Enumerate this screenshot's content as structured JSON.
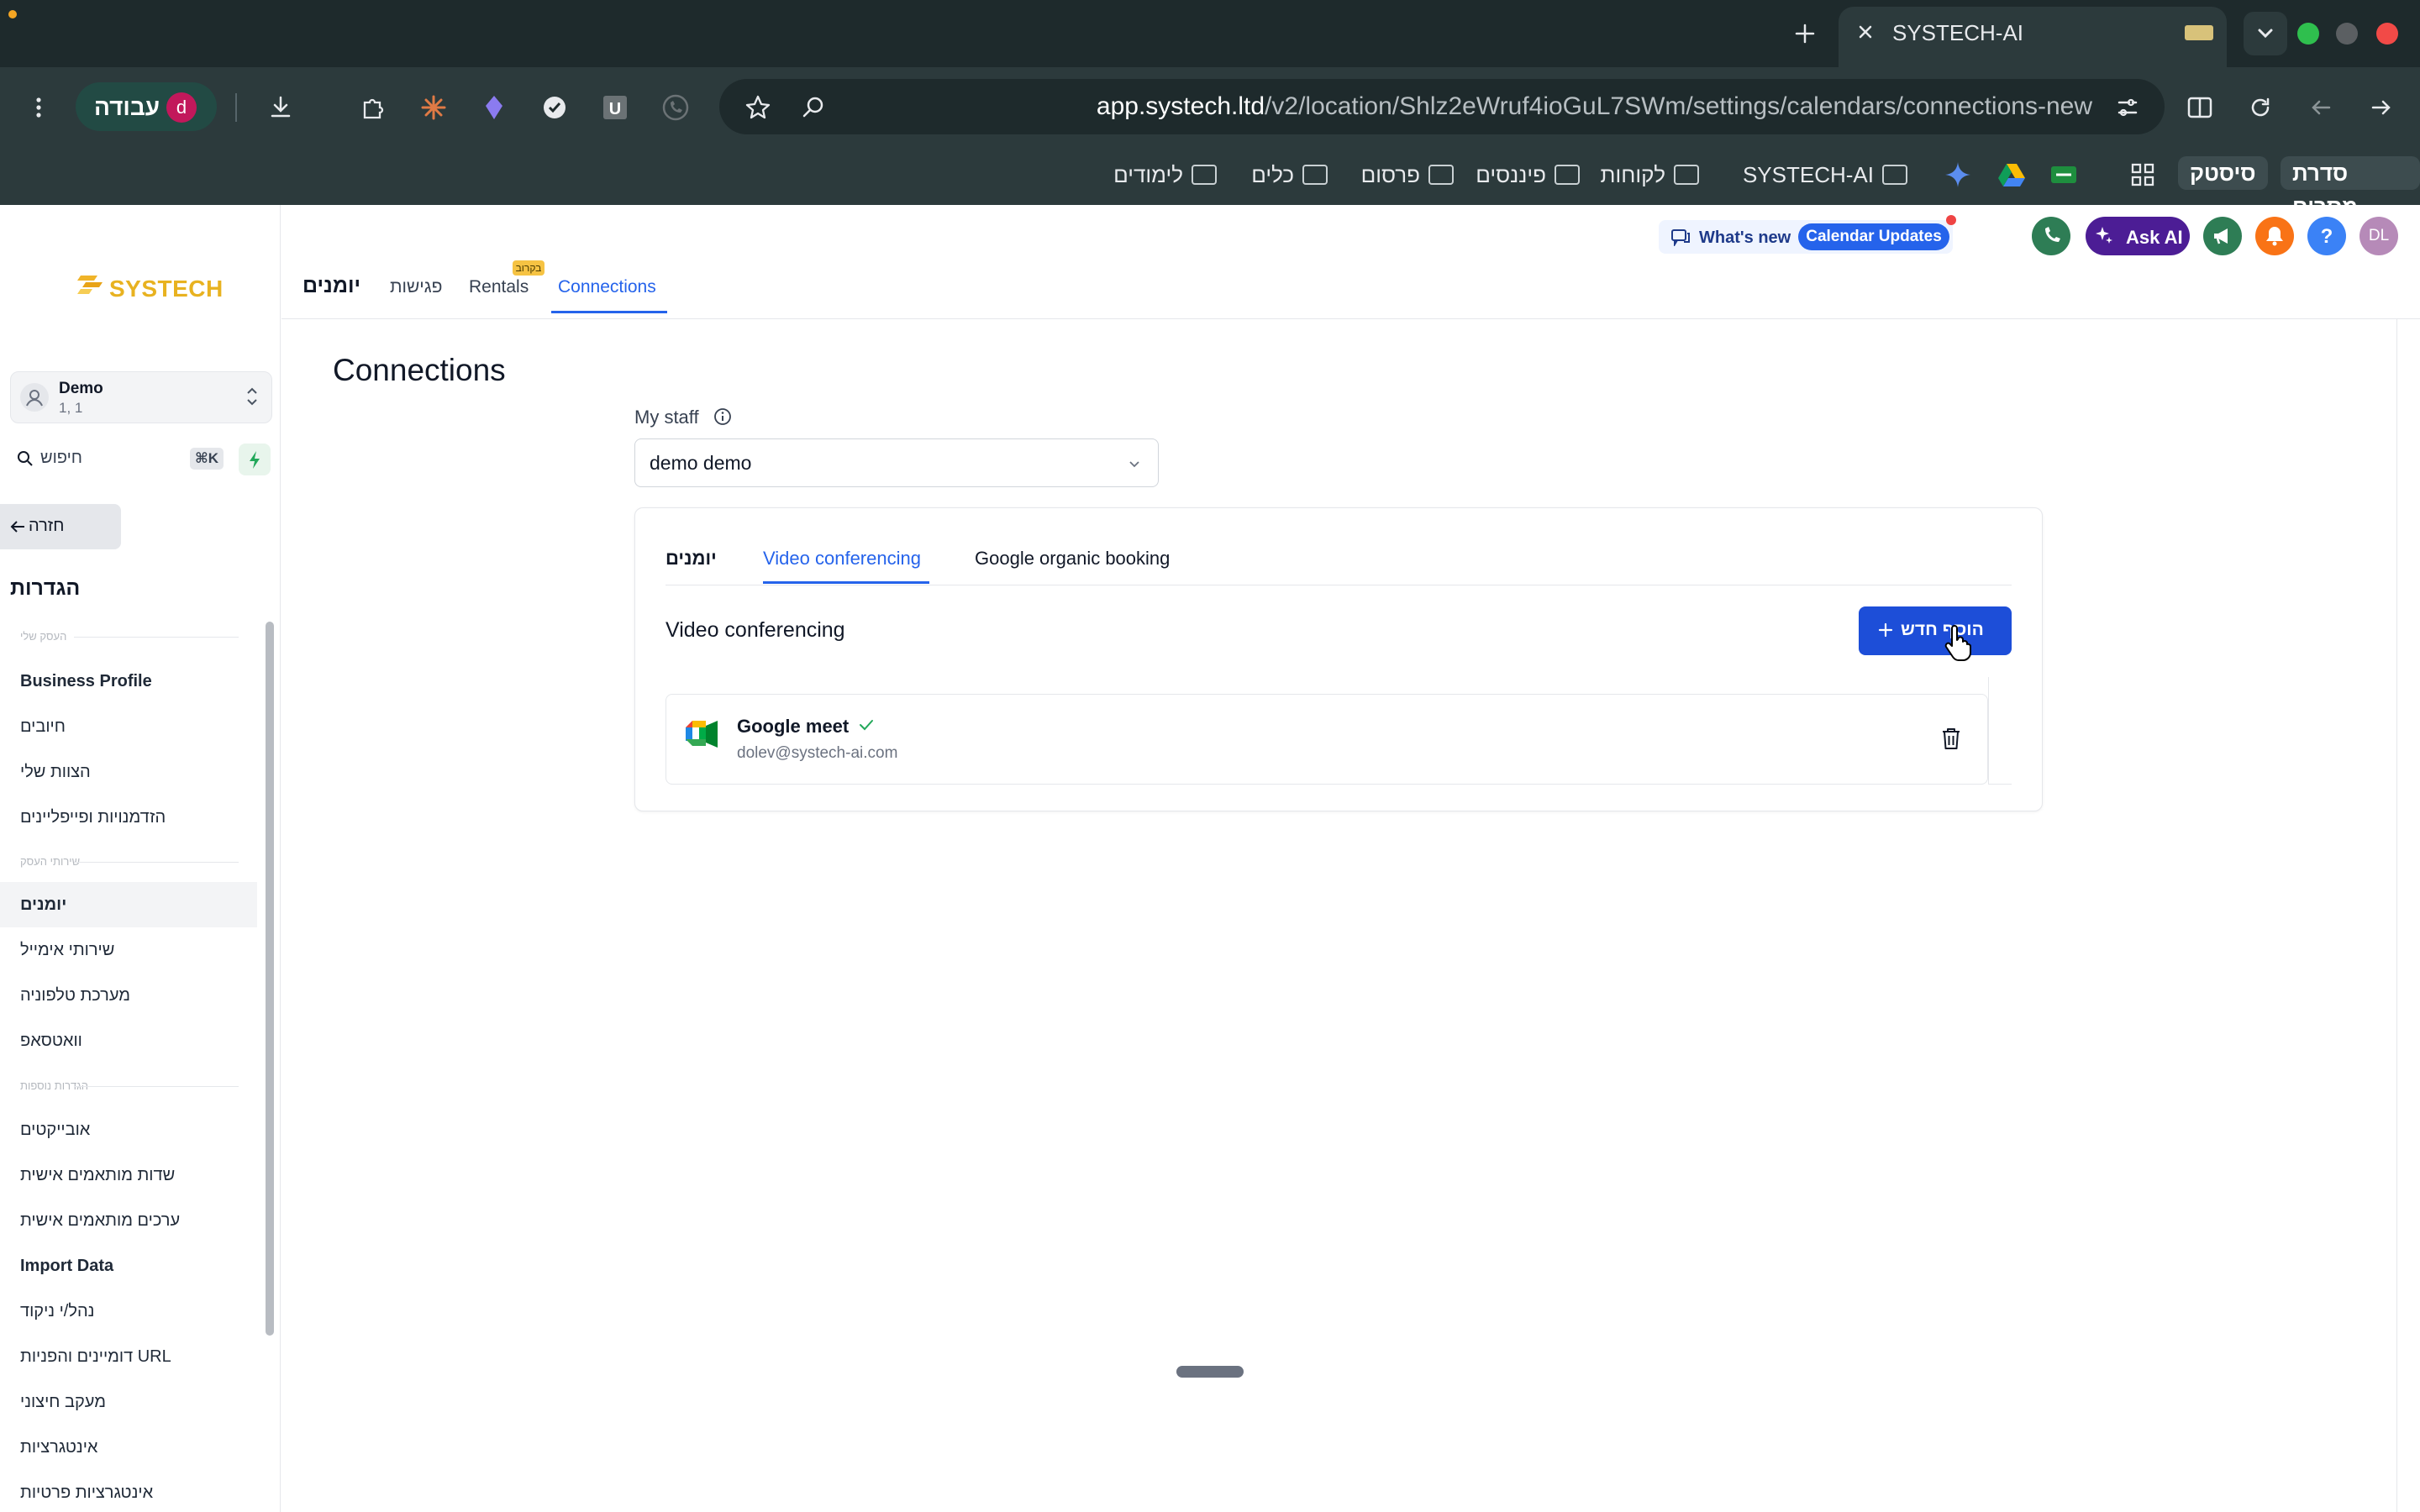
{
  "browser": {
    "tab_title": "SYSTECH-AI",
    "url_host": "app.systech.ltd",
    "url_path": "/v2/location/Shlz2eWruf4ioGuL7SWm/settings/calendars/connections-new",
    "profile_label": "עבודה",
    "profile_initial": "d",
    "bookmarks": [
      {
        "label": "סדרת מסרים",
        "pill": true
      },
      {
        "label": "סיסטק",
        "pill": true
      },
      {
        "label": "SYSTECH-AI"
      },
      {
        "label": "לקוחות"
      },
      {
        "label": "פיננסים"
      },
      {
        "label": "פרסום"
      },
      {
        "label": "כלים"
      },
      {
        "label": "לימודים"
      }
    ]
  },
  "sidebar": {
    "logo": "SYSTECH",
    "account": {
      "name": "Demo",
      "sub": "1, 1"
    },
    "search": {
      "placeholder": "חיפוש",
      "shortcut": "⌘K"
    },
    "back_label": "חזרה",
    "settings_title": "הגדרות",
    "sections": [
      {
        "title": "העסק שלי"
      },
      {
        "title": "שירותי העסק"
      },
      {
        "title": "הגדרות נוספות"
      }
    ],
    "items": [
      {
        "label": "Business Profile",
        "bold": true
      },
      {
        "label": "חיובים"
      },
      {
        "label": "הצוות שלי"
      },
      {
        "label": "הזדמנויות ופייפליינים"
      },
      {
        "label": "יומנים",
        "active": true
      },
      {
        "label": "שירותי אימייל"
      },
      {
        "label": "מערכת טלפוניה"
      },
      {
        "label": "וואטסאפ"
      },
      {
        "label": "אובייקטים"
      },
      {
        "label": "שדות מותאמים אישית"
      },
      {
        "label": "ערכים מותאמים אישית"
      },
      {
        "label": "Import Data",
        "bold": true
      },
      {
        "label": "נהל/י ניקוד"
      },
      {
        "label": "דומיינים והפניות URL"
      },
      {
        "label": "מעקב חיצוני"
      },
      {
        "label": "אינטגרציות"
      },
      {
        "label": "אינטגרציות פרטיות"
      }
    ]
  },
  "header": {
    "tabs": [
      {
        "label": "יומנים"
      },
      {
        "label": "פגישות"
      },
      {
        "label": "Rentals",
        "badge": "בקרוב"
      },
      {
        "label": "Connections",
        "active": true
      }
    ],
    "whats_new": "What's new",
    "calendar_updates": "Calendar Updates",
    "ask_ai": "Ask AI",
    "avatar_initials": "DL"
  },
  "main": {
    "page_title": "Connections",
    "staff_label": "My staff",
    "staff_value": "demo demo",
    "card_tabs": [
      {
        "label": "יומנים"
      },
      {
        "label": "Video conferencing",
        "active": true
      },
      {
        "label": "Google organic booking"
      }
    ],
    "section_title": "Video conferencing",
    "add_new_label": "הוסף חדש",
    "connection": {
      "name": "Google meet",
      "email": "dolev@systech-ai.com",
      "verified": true
    }
  },
  "colors": {
    "accent": "#2563eb",
    "button": "#1d4ed8",
    "chrome_bg": "#2c3a3c"
  }
}
